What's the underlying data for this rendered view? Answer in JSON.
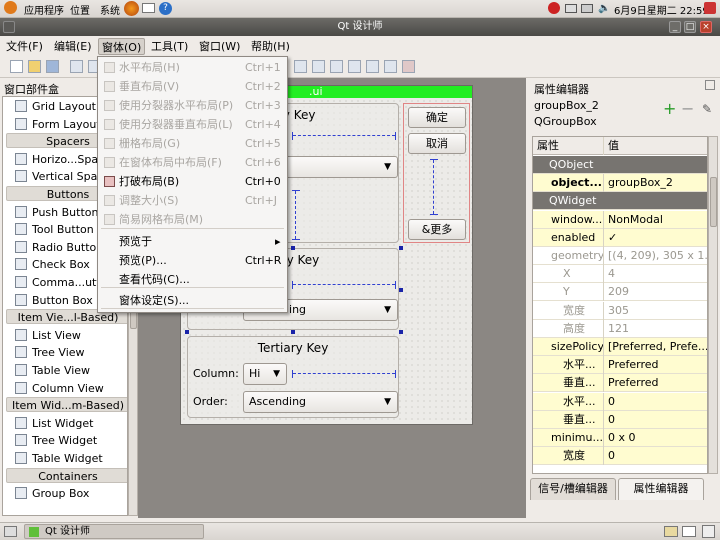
{
  "top_panel": {
    "menus": [
      "应用程序",
      "位置",
      "系统"
    ],
    "datetime": "6月9日星期二  22:59"
  },
  "window": {
    "title": "Qt 设计师"
  },
  "menubar": [
    "文件(F)",
    "编辑(E)",
    "窗体(O)",
    "工具(T)",
    "窗口(W)",
    "帮助(H)"
  ],
  "widget_box": {
    "title": "窗口部件盒",
    "items": [
      {
        "kind": "item",
        "label": "Grid Layout"
      },
      {
        "kind": "item",
        "label": "Form Layout"
      },
      {
        "kind": "cat",
        "label": "Spacers"
      },
      {
        "kind": "item",
        "label": "Horizo...Spacer"
      },
      {
        "kind": "item",
        "label": "Vertical Spacer"
      },
      {
        "kind": "cat",
        "label": "Buttons"
      },
      {
        "kind": "item",
        "label": "Push Button"
      },
      {
        "kind": "item",
        "label": "Tool Button"
      },
      {
        "kind": "item",
        "label": "Radio Button"
      },
      {
        "kind": "item",
        "label": "Check Box"
      },
      {
        "kind": "item",
        "label": "Comma...utton"
      },
      {
        "kind": "item",
        "label": "Button Box"
      },
      {
        "kind": "cat",
        "label": "Item Vie...l-Based)"
      },
      {
        "kind": "item",
        "label": "List View"
      },
      {
        "kind": "item",
        "label": "Tree View"
      },
      {
        "kind": "item",
        "label": "Table View"
      },
      {
        "kind": "item",
        "label": "Column View"
      },
      {
        "kind": "cat",
        "label": "Item Wid...m-Based)"
      },
      {
        "kind": "item",
        "label": "List Widget"
      },
      {
        "kind": "item",
        "label": "Tree Widget"
      },
      {
        "kind": "item",
        "label": "Table Widget"
      },
      {
        "kind": "cat",
        "label": "Containers"
      },
      {
        "kind": "item",
        "label": "Group Box"
      }
    ]
  },
  "form": {
    "title_fragment": ".ui",
    "primary_title": "ary Key",
    "primary_combo": "ding",
    "secondary_title": "dary Key",
    "secondary_order_label": "Order:",
    "secondary_order_value": "Ascending",
    "tertiary_title": "Tertiary Key",
    "column_label": "Column:",
    "column_value": "Hi",
    "order_label": "Order:",
    "order_value": "Ascending",
    "ok_button": "确定",
    "cancel_button": "取消",
    "more_button": "&更多"
  },
  "dropdown": {
    "items": [
      {
        "label": "水平布局(H)",
        "shortcut": "Ctrl+1",
        "disabled": true
      },
      {
        "label": "垂直布局(V)",
        "shortcut": "Ctrl+2",
        "disabled": true
      },
      {
        "label": "使用分裂器水平布局(P)",
        "shortcut": "Ctrl+3",
        "disabled": true
      },
      {
        "label": "使用分裂器垂直布局(L)",
        "shortcut": "Ctrl+4",
        "disabled": true
      },
      {
        "label": "栅格布局(G)",
        "shortcut": "Ctrl+5",
        "disabled": true
      },
      {
        "label": "在窗体布局中布局(F)",
        "shortcut": "Ctrl+6",
        "disabled": true
      },
      {
        "label": "打破布局(B)",
        "shortcut": "Ctrl+0",
        "disabled": false
      },
      {
        "label": "调整大小(S)",
        "shortcut": "Ctrl+J",
        "disabled": true
      },
      {
        "label": "简易网格布局(M)",
        "shortcut": "",
        "disabled": true
      },
      {
        "label": "预览于",
        "shortcut": "▸",
        "disabled": false
      },
      {
        "label": "预览(P)...",
        "shortcut": "Ctrl+R",
        "disabled": false
      },
      {
        "label": "查看代码(C)...",
        "shortcut": "",
        "disabled": false
      },
      {
        "label": "窗体设定(S)...",
        "shortcut": "",
        "disabled": false
      }
    ]
  },
  "property_editor": {
    "title": "属性编辑器",
    "object_name": "groupBox_2",
    "class_name": "QGroupBox",
    "header_prop": "属性",
    "header_value": "值",
    "rows": [
      {
        "t": "sec",
        "n": "QObject",
        "v": ""
      },
      {
        "t": "y",
        "n": "object...",
        "v": "groupBox_2"
      },
      {
        "t": "sec",
        "n": "QWidget",
        "v": ""
      },
      {
        "t": "y",
        "n": "window...",
        "v": "NonModal"
      },
      {
        "t": "y",
        "n": "enabled",
        "v": "✓"
      },
      {
        "t": "g",
        "n": "geometry",
        "v": "[(4, 209), 305 x 1..."
      },
      {
        "t": "g",
        "n": "X",
        "v": "4"
      },
      {
        "t": "g",
        "n": "Y",
        "v": "209"
      },
      {
        "t": "g",
        "n": "宽度",
        "v": "305"
      },
      {
        "t": "g",
        "n": "高度",
        "v": "121"
      },
      {
        "t": "y",
        "n": "sizePolicy",
        "v": "[Preferred, Prefe..."
      },
      {
        "t": "y",
        "n": "水平...",
        "v": "Preferred"
      },
      {
        "t": "y",
        "n": "垂直...",
        "v": "Preferred"
      },
      {
        "t": "y",
        "n": "水平...",
        "v": "0"
      },
      {
        "t": "y",
        "n": "垂直...",
        "v": "0"
      },
      {
        "t": "y",
        "n": "minimu...",
        "v": "0 x 0"
      },
      {
        "t": "y",
        "n": "宽度",
        "v": "0"
      }
    ],
    "tab_signals": "信号/槽编辑器",
    "tab_props": "属性编辑器"
  },
  "taskbar": {
    "task_label": "Qt 设计师"
  }
}
